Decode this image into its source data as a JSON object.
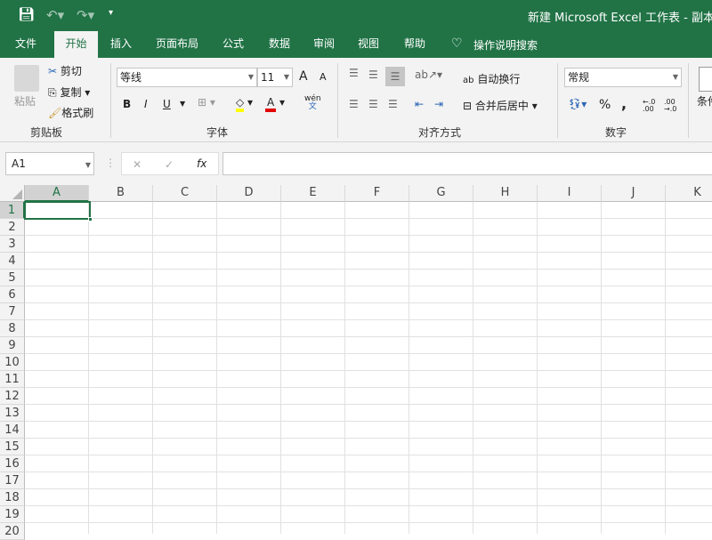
{
  "title": "新建 Microsoft Excel 工作表 - 副本.xl",
  "tabs": [
    "文件",
    "开始",
    "插入",
    "页面布局",
    "公式",
    "数据",
    "审阅",
    "视图",
    "帮助"
  ],
  "tell_me": "操作说明搜索",
  "clipboard": {
    "paste": "粘贴",
    "cut": "剪切",
    "copy": "复制",
    "format_painter": "格式刷",
    "label": "剪贴板"
  },
  "font": {
    "name": "等线",
    "size": "11",
    "bold": "B",
    "italic": "I",
    "underline": "U",
    "label": "字体",
    "phonetic_top": "wén",
    "phonetic_bottom": "文",
    "grow": "A",
    "shrink": "A",
    "font_color": "A"
  },
  "alignment": {
    "wrap": "自动换行",
    "merge": "合并后居中",
    "label": "对齐方式"
  },
  "number": {
    "format": "常规",
    "percent": "%",
    "comma": ",",
    "label": "数字",
    "inc": "←.0 .00",
    "dec": ".00 →.0"
  },
  "styles": {
    "conditional": "条件"
  },
  "formula_bar": {
    "name_box": "A1",
    "fx": "fx",
    "cancel": "✕",
    "enter": "✓",
    "value": ""
  },
  "columns": [
    "A",
    "B",
    "C",
    "D",
    "E",
    "F",
    "G",
    "H",
    "I",
    "J",
    "K"
  ],
  "rows": [
    "1",
    "2",
    "3",
    "4",
    "5",
    "6",
    "7",
    "8",
    "9",
    "10",
    "11",
    "12",
    "13",
    "14",
    "15",
    "16",
    "17",
    "18",
    "19",
    "20"
  ],
  "colors": {
    "brand": "#217346",
    "fill": "#ffff00",
    "font": "#e00000"
  }
}
